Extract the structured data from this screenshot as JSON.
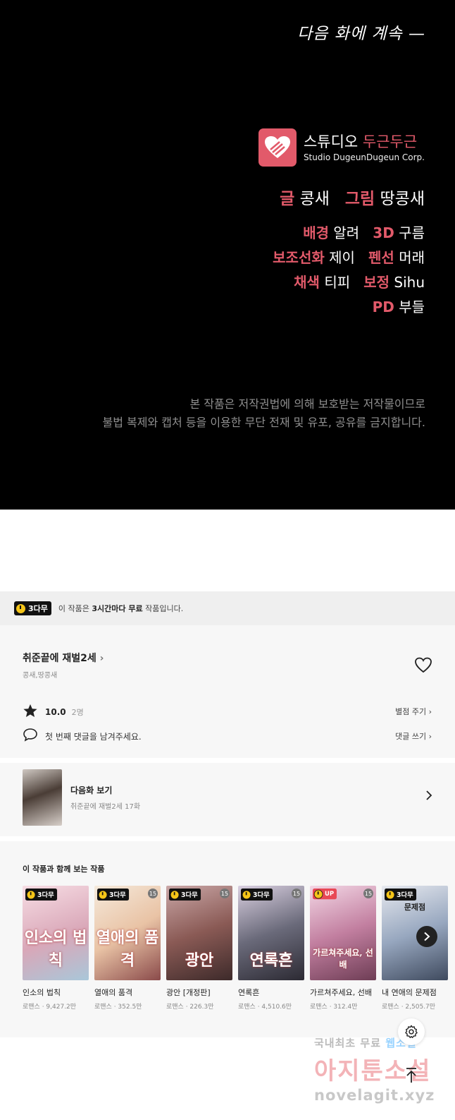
{
  "comic": {
    "next_episode": "다음 화에 계속 —",
    "studio": {
      "name_plain": "스튜디오 ",
      "name_accent": "두근두근",
      "sub": "Studio DugeunDugeun Corp."
    },
    "credits_main": [
      {
        "role": "글",
        "name": "콩새"
      },
      {
        "role": "그림",
        "name": "땅콩새"
      }
    ],
    "credits": [
      [
        {
          "role": "배경",
          "name": "알려"
        },
        {
          "role": "3D",
          "name": "구름"
        }
      ],
      [
        {
          "role": "보조선화",
          "name": "제이"
        },
        {
          "role": "펜선",
          "name": "머래"
        }
      ],
      [
        {
          "role": "채색",
          "name": "티피"
        },
        {
          "role": "보정",
          "name": "Sihu"
        }
      ],
      [
        {
          "role": "PD",
          "name": "부들"
        }
      ]
    ],
    "notice_line1": "본 작품은 저작권법에 의해 보호받는 저작물이므로",
    "notice_line2": "불법 복제와 캡처 등을 이용한 무단 전재 및 유포, 공유를 금지합니다.",
    "accent_color": "#e25a6a"
  },
  "banner": {
    "badge": "3다무",
    "text_prefix": "이 작품은 ",
    "text_bold": "3시간마다 무료",
    "text_suffix": " 작품입니다."
  },
  "work": {
    "title": "취준끝에 재벌2세",
    "author": "콩새,땅콩새",
    "rating": "10.0",
    "rating_count": "2명",
    "rate_label": "별점 주기",
    "comment_placeholder": "첫 번째 댓글을 남겨주세요.",
    "comment_label": "댓글 쓰기"
  },
  "next_view": {
    "title": "다음화 보기",
    "subtitle": "취준끝에 재벌2세 17화"
  },
  "recommend": {
    "heading": "이 작품과 함께 보는 작품",
    "items": [
      {
        "title": "인소의 법칙",
        "meta": "로맨스 · 9,427.2만",
        "tag": "3다무",
        "age": "",
        "art": "인소의 법칙"
      },
      {
        "title": "열애의 품격",
        "meta": "로맨스 · 352.5만",
        "tag": "3다무",
        "age": "15",
        "art": "열애의 품격"
      },
      {
        "title": "광안 [개정판]",
        "meta": "로맨스 · 226.3만",
        "tag": "3다무",
        "age": "15",
        "art": "광안"
      },
      {
        "title": "연록흔",
        "meta": "로맨스 · 4,510.6만",
        "tag": "3다무",
        "age": "15",
        "art": "연록흔"
      },
      {
        "title": "가르쳐주세요, 선배",
        "meta": "로맨스 · 312.4만",
        "tag": "UP",
        "age": "15",
        "art": "가르쳐주세요, 선배"
      },
      {
        "title": "내 연애의 문제점",
        "meta": "로맨스 · 2,505.7만",
        "tag": "3다무",
        "age": "",
        "art": "문제점"
      }
    ]
  },
  "watermark": {
    "line1_plain": "국내최초 무료 ",
    "line1_hl": "웹소설",
    "line2": "아지툰소설",
    "line3": "novelagit.xyz"
  }
}
